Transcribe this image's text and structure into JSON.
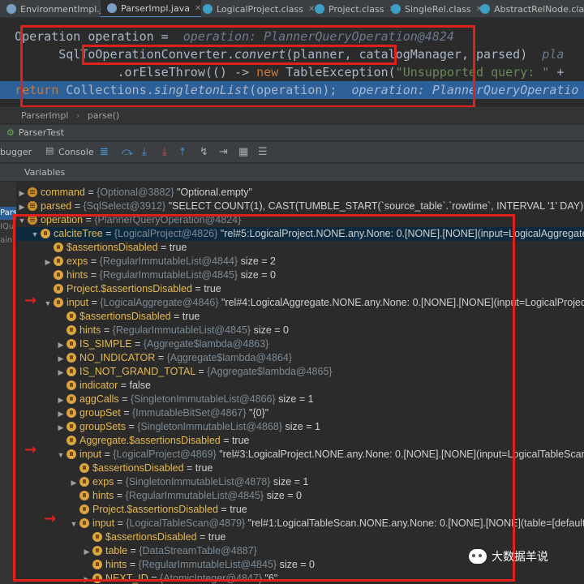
{
  "tabs": [
    {
      "label": "EnvironmentImpl.java",
      "active": false
    },
    {
      "label": "ParserImpl.java",
      "active": true
    },
    {
      "label": "LogicalProject.class",
      "active": false
    },
    {
      "label": "Project.class",
      "active": false
    },
    {
      "label": "SingleRel.class",
      "active": false
    },
    {
      "label": "AbstractRelNode.class",
      "active": false
    }
  ],
  "code": {
    "line1_code": "Operation operation = ",
    "line1_hint": " operation: PlannerQueryOperation@4824",
    "line2_pre": "        ",
    "line2_a": "SqlToOperationConverter.",
    "line2_method": "convert",
    "line2_b": "(planner, catalogManager, parsed)",
    "line2_hint": "  pla",
    "line3_pre": "                .orElseThrow(() -> ",
    "line3_kw": "new",
    "line3_b": " TableException(",
    "line3_str": "\"Unsupported query: \"",
    "line3_c": " +",
    "line4_kw": "return",
    "line4_a": " Collections.",
    "line4_method": "singletonList",
    "line4_b": "(operation);",
    "line4_hint": "  operation: PlannerQueryOperatio"
  },
  "breadcrumb": {
    "class": "ParserImpl",
    "method": "parse()"
  },
  "run": {
    "label": "ParserTest"
  },
  "toolbar": {
    "debugger": "bugger",
    "console": "Console"
  },
  "vars": {
    "label": "Variables"
  },
  "left_gutter": [
    "Parser",
    "IQu",
    "ain"
  ],
  "tree": [
    {
      "indent": 0,
      "arrow": "▶",
      "icon": "lines",
      "name": "command",
      "ref": "{Optional@3882}",
      "val": " \"Optional.empty\""
    },
    {
      "indent": 0,
      "arrow": "▶",
      "icon": "lines",
      "name": "parsed",
      "ref": "{SqlSelect@3912}",
      "val": " \"SELECT COUNT(1), CAST(TUMBLE_START(`source_table`.`rowtime`, INTERVAL '1' DAY) AS"
    },
    {
      "indent": 0,
      "arrow": "▼",
      "icon": "lines",
      "name": "operation",
      "ref": "{PlannerQueryOperation@4824}",
      "val": ""
    },
    {
      "indent": 1,
      "arrow": "▼",
      "icon": "lock",
      "name": "calciteTree",
      "ref": "{LogicalProject@4826}",
      "val": " \"rel#5:LogicalProject.NONE.any.None: 0.[NONE].[NONE](input=LogicalAggregate",
      "sel": true
    },
    {
      "indent": 2,
      "arrow": "",
      "icon": "lock",
      "name": "$assertionsDisabled",
      "ref": "",
      "val": " = true"
    },
    {
      "indent": 2,
      "arrow": "▶",
      "icon": "lock",
      "name": "exps",
      "ref": "{RegularImmutableList@4844}",
      "val": "  size = 2"
    },
    {
      "indent": 2,
      "arrow": "",
      "icon": "lock",
      "name": "hints",
      "ref": "{RegularImmutableList@4845}",
      "val": "  size = 0"
    },
    {
      "indent": 2,
      "arrow": "",
      "icon": "lock",
      "name": "Project.$assertionsDisabled",
      "ref": "",
      "val": " = true"
    },
    {
      "indent": 2,
      "arrow": "▼",
      "icon": "lock",
      "name": "input",
      "ref": "{LogicalAggregate@4846}",
      "val": " \"rel#4:LogicalAggregate.NONE.any.None: 0.[NONE].[NONE](input=LogicalProjec"
    },
    {
      "indent": 3,
      "arrow": "",
      "icon": "lock",
      "name": "$assertionsDisabled",
      "ref": "",
      "val": " = true"
    },
    {
      "indent": 3,
      "arrow": "",
      "icon": "lock",
      "name": "hints",
      "ref": "{RegularImmutableList@4845}",
      "val": "  size = 0"
    },
    {
      "indent": 3,
      "arrow": "▶",
      "icon": "lock",
      "name": "IS_SIMPLE",
      "ref": "{Aggregate$lambda@4863}",
      "val": ""
    },
    {
      "indent": 3,
      "arrow": "▶",
      "icon": "lock",
      "name": "NO_INDICATOR",
      "ref": "{Aggregate$lambda@4864}",
      "val": ""
    },
    {
      "indent": 3,
      "arrow": "▶",
      "icon": "lock",
      "name": "IS_NOT_GRAND_TOTAL",
      "ref": "{Aggregate$lambda@4865}",
      "val": ""
    },
    {
      "indent": 3,
      "arrow": "",
      "icon": "lock",
      "name": "indicator",
      "ref": "",
      "val": " = false"
    },
    {
      "indent": 3,
      "arrow": "▶",
      "icon": "lock",
      "name": "aggCalls",
      "ref": "{SingletonImmutableList@4866}",
      "val": "  size = 1"
    },
    {
      "indent": 3,
      "arrow": "▶",
      "icon": "lock",
      "name": "groupSet",
      "ref": "{ImmutableBitSet@4867}",
      "val": " \"{0}\""
    },
    {
      "indent": 3,
      "arrow": "▶",
      "icon": "lock",
      "name": "groupSets",
      "ref": "{SingletonImmutableList@4868}",
      "val": "  size = 1"
    },
    {
      "indent": 3,
      "arrow": "",
      "icon": "lock",
      "name": "Aggregate.$assertionsDisabled",
      "ref": "",
      "val": " = true"
    },
    {
      "indent": 3,
      "arrow": "▼",
      "icon": "lock",
      "name": "input",
      "ref": "{LogicalProject@4869}",
      "val": " \"rel#3:LogicalProject.NONE.any.None: 0.[NONE].[NONE](input=LogicalTableScan"
    },
    {
      "indent": 4,
      "arrow": "",
      "icon": "lock",
      "name": "$assertionsDisabled",
      "ref": "",
      "val": " = true"
    },
    {
      "indent": 4,
      "arrow": "▶",
      "icon": "lock",
      "name": "exps",
      "ref": "{SingletonImmutableList@4878}",
      "val": "  size = 1"
    },
    {
      "indent": 4,
      "arrow": "",
      "icon": "lock",
      "name": "hints",
      "ref": "{RegularImmutableList@4845}",
      "val": "  size = 0"
    },
    {
      "indent": 4,
      "arrow": "",
      "icon": "lock",
      "name": "Project.$assertionsDisabled",
      "ref": "",
      "val": " = true"
    },
    {
      "indent": 4,
      "arrow": "▼",
      "icon": "lock",
      "name": "input",
      "ref": "{LogicalTableScan@4879}",
      "val": " \"rel#1:LogicalTableScan.NONE.any.None: 0.[NONE].[NONE](table=[default_"
    },
    {
      "indent": 5,
      "arrow": "",
      "icon": "lock",
      "name": "$assertionsDisabled",
      "ref": "",
      "val": " = true"
    },
    {
      "indent": 5,
      "arrow": "▶",
      "icon": "lock",
      "name": "table",
      "ref": "{DataStreamTable@4887}",
      "val": ""
    },
    {
      "indent": 5,
      "arrow": "",
      "icon": "lock",
      "name": "hints",
      "ref": "{RegularImmutableList@4845}",
      "val": "  size = 0"
    },
    {
      "indent": 5,
      "arrow": "▶",
      "icon": "lock",
      "name": "NEXT_ID",
      "ref": "{AtomicInteger@4847}",
      "val": " \"6\""
    }
  ],
  "watermark": {
    "text": "大数据羊说"
  },
  "colors": {
    "accent": "#e0201a",
    "selection": "#2d6099"
  }
}
